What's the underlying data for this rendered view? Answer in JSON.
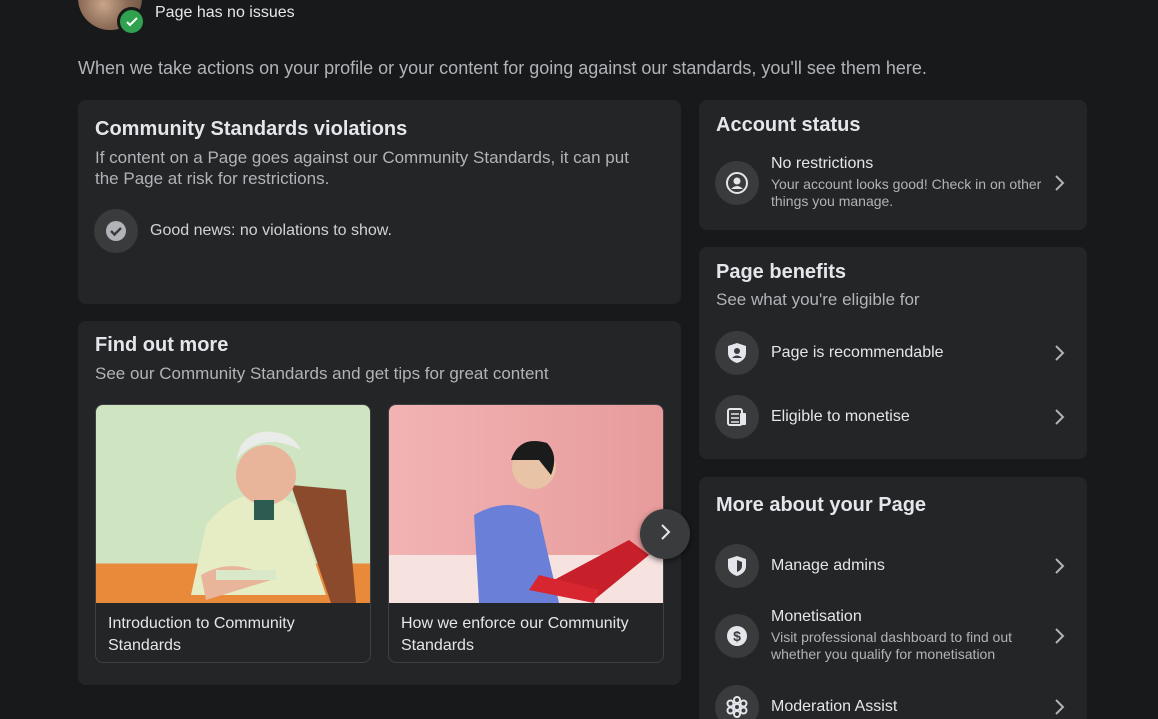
{
  "header": {
    "status": "Page has no issues",
    "intro": "When we take actions on your profile or your content for going against our standards, you'll see them here."
  },
  "violations": {
    "title": "Community Standards violations",
    "subtitle": "If content on a Page goes against our Community Standards, it can put the Page at risk for restrictions.",
    "message": "Good news: no violations to show."
  },
  "find_out_more": {
    "title": "Find out more",
    "subtitle": "See our Community Standards and get tips for great content",
    "tiles": [
      {
        "caption": "Introduction to Community Standards"
      },
      {
        "caption": "How we enforce our Community Standards"
      }
    ]
  },
  "account_status": {
    "title": "Account status",
    "item": {
      "label": "No restrictions",
      "desc": "Your account looks good! Check in on other things you manage.",
      "icon": "person-circle-icon"
    }
  },
  "page_benefits": {
    "title": "Page benefits",
    "subtitle": "See what you're eligible for",
    "items": [
      {
        "label": "Page is recommendable",
        "icon": "shield-person-icon"
      },
      {
        "label": "Eligible to monetise",
        "icon": "money-stack-icon"
      }
    ]
  },
  "more_about": {
    "title": "More about your Page",
    "items": [
      {
        "label": "Manage admins",
        "icon": "shield-icon"
      },
      {
        "label": "Monetisation",
        "desc": "Visit professional dashboard to find out whether you qualify for monetisation",
        "icon": "dollar-circle-icon"
      },
      {
        "label": "Moderation Assist",
        "icon": "gear-flower-icon"
      }
    ]
  },
  "colors": {
    "background": "#18191a",
    "card": "#242526",
    "success": "#30a14e"
  }
}
